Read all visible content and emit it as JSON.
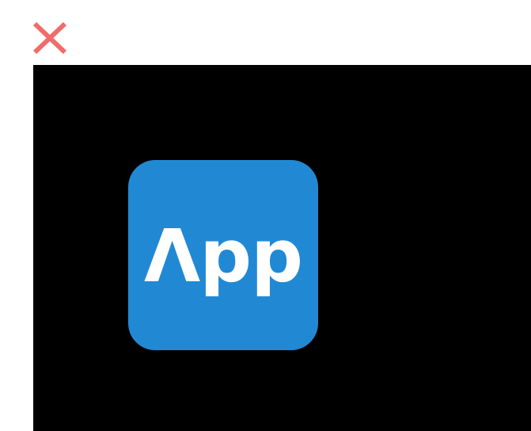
{
  "toolbar": {
    "close_icon": "close-icon",
    "close_color": "#f06c6c"
  },
  "canvas": {
    "background": "#000000",
    "app_icon": {
      "label": "Λpp",
      "color": "#2189d4"
    }
  }
}
